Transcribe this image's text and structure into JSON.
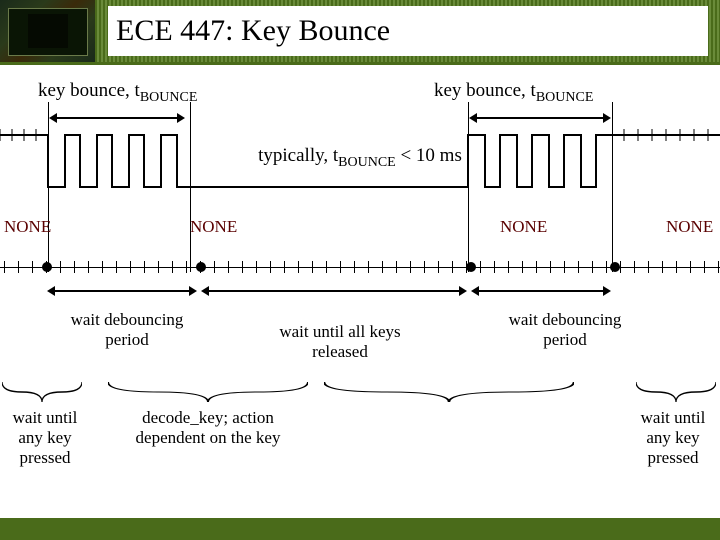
{
  "title": "ECE 447: Key Bounce",
  "key_bounce_label_left": "key bounce, t",
  "key_bounce_label_right": "key bounce, t",
  "bounce_sub": "BOUNCE",
  "typical": "typically, t",
  "typical2": " < 10 ms",
  "none": "NONE",
  "wait_debounce": "wait debouncing period",
  "wait_released": "wait until all keys released",
  "wait_pressed": "wait until any key pressed",
  "decode": "decode_key; action dependent on the key"
}
